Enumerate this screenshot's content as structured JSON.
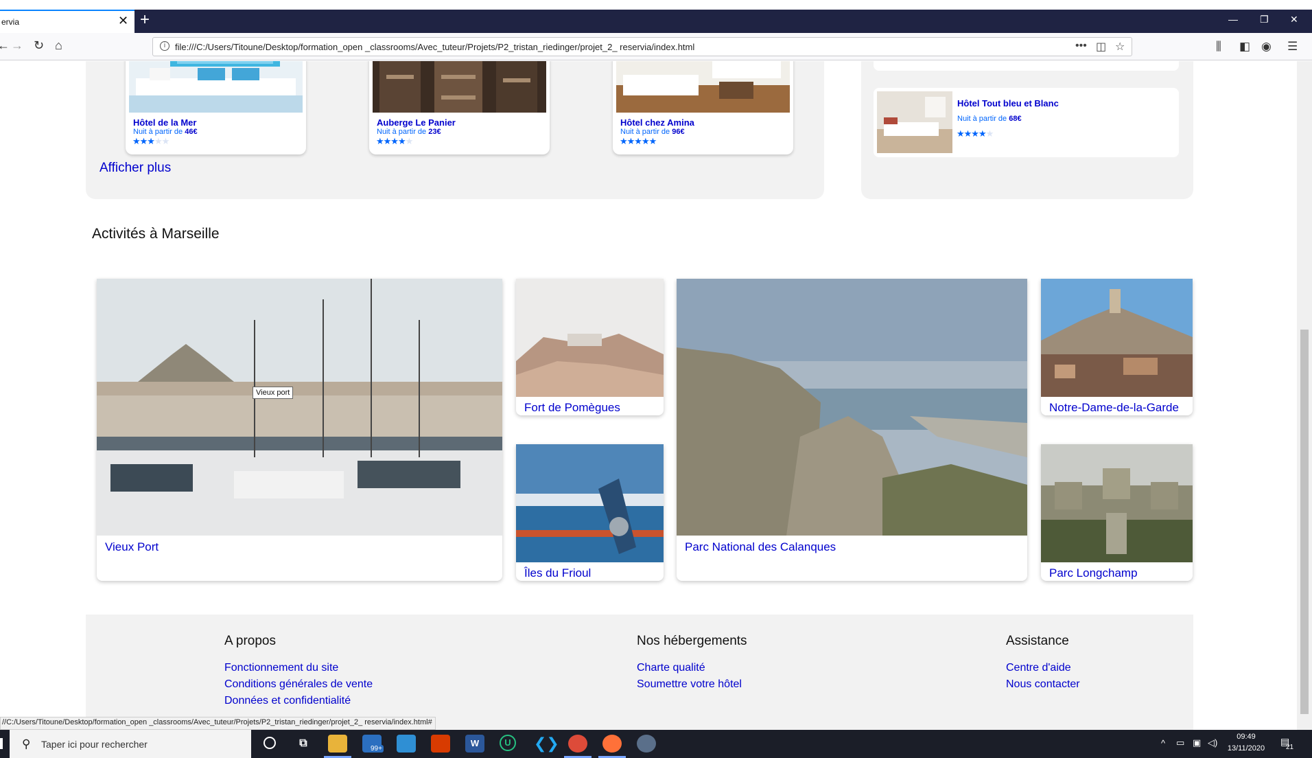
{
  "browser": {
    "tab_title": "ervia",
    "url": "file:///C:/Users/Titoune/Desktop/formation_open _classrooms/Avec_tuteur/Projets/P2_tristan_riedinger/projet_2_ reservia/index.html"
  },
  "hotels": [
    {
      "name": "Hôtel de la Mer",
      "price_prefix": "Nuit à partir de ",
      "price": "46€",
      "stars": 3
    },
    {
      "name": "Auberge Le Panier",
      "price_prefix": "Nuit à partir de ",
      "price": "23€",
      "stars": 4
    },
    {
      "name": "Hôtel chez Amina",
      "price_prefix": "Nuit à partir de ",
      "price": "96€",
      "stars": 5
    }
  ],
  "show_more": "Afficher plus",
  "popular": {
    "name": "Hôtel Tout bleu et Blanc",
    "price_prefix": "Nuit à partir de ",
    "price": "68€",
    "stars": 4
  },
  "activities": {
    "title": "Activités à Marseille",
    "tooltip": "Vieux port",
    "items": [
      {
        "label": "Vieux Port"
      },
      {
        "label": "Fort de Pomègues"
      },
      {
        "label": "Îles du Frioul"
      },
      {
        "label": "Parc National des Calanques"
      },
      {
        "label": "Notre-Dame-de-la-Garde"
      },
      {
        "label": "Parc Longchamp"
      }
    ]
  },
  "footer": {
    "about": {
      "title": "A propos",
      "links": [
        "Fonctionnement du site",
        "Conditions générales de vente",
        "Données et confidentialité"
      ]
    },
    "lodging": {
      "title": "Nos hébergements",
      "links": [
        "Charte qualité",
        "Soumettre votre hôtel"
      ]
    },
    "help": {
      "title": "Assistance",
      "links": [
        "Centre d'aide",
        "Nous contacter"
      ]
    }
  },
  "status_url": "//C:/Users/Titoune/Desktop/formation_open _classrooms/Avec_tuteur/Projets/P2_tristan_riedinger/projet_2_ reservia/index.html#",
  "taskbar": {
    "search_placeholder": "Taper ici pour rechercher",
    "mail_badge": "99+",
    "time": "09:49",
    "date": "13/11/2020",
    "notifications": "21"
  }
}
